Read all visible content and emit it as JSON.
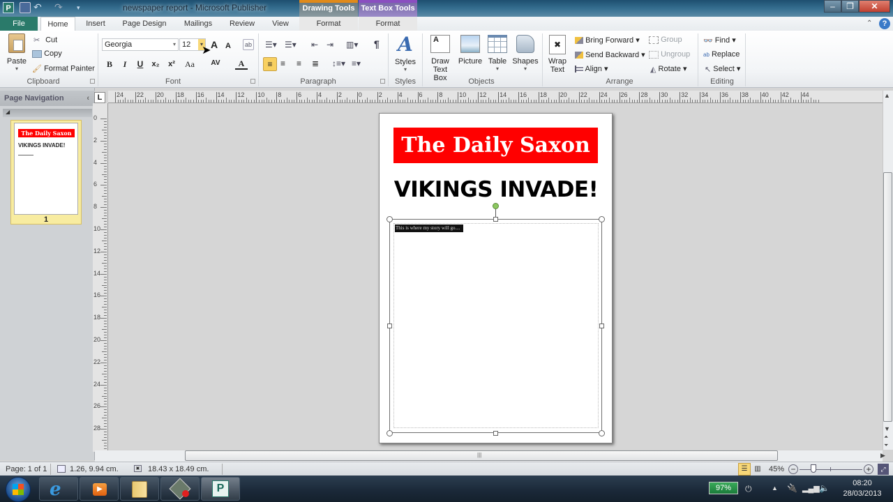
{
  "window": {
    "title": "newspaper report - Microsoft Publisher",
    "app_icon": "publisher-icon",
    "quick_access": [
      "save-icon",
      "undo-icon",
      "redo-icon",
      "customize-qat-icon"
    ],
    "controls": {
      "minimize": "–",
      "maximize": "❐",
      "close": "✕"
    }
  },
  "contextual_tabs": [
    {
      "group": "Drawing Tools",
      "tab": "Format",
      "color": "#e08a1a"
    },
    {
      "group": "Text Box Tools",
      "tab": "Format",
      "color": "#8a4ec0"
    }
  ],
  "tabs": [
    "File",
    "Home",
    "Insert",
    "Page Design",
    "Mailings",
    "Review",
    "View"
  ],
  "active_tab": "Home",
  "ribbon": {
    "clipboard": {
      "label": "Clipboard",
      "paste": "Paste",
      "cut": "Cut",
      "copy": "Copy",
      "format_painter": "Format Painter"
    },
    "font": {
      "label": "Font",
      "font_name": "Georgia",
      "font_size": "12",
      "bold": "B",
      "italic": "I",
      "underline": "U",
      "subscript": "x₂",
      "superscript": "x²",
      "change_case": "Aa",
      "char_spacing": "AV",
      "font_color": "A",
      "grow": "A",
      "shrink": "A"
    },
    "paragraph": {
      "label": "Paragraph",
      "show_marks": "¶"
    },
    "styles": {
      "label": "Styles",
      "button": "Styles"
    },
    "objects": {
      "label": "Objects",
      "draw_text_box": "Draw Text Box",
      "draw_text_box_l1": "Draw",
      "draw_text_box_l2": "Text Box",
      "picture": "Picture",
      "table": "Table",
      "shapes": "Shapes"
    },
    "arrange": {
      "label": "Arrange",
      "wrap_text_l1": "Wrap",
      "wrap_text_l2": "Text",
      "bring_forward": "Bring Forward",
      "send_backward": "Send Backward",
      "align": "Align",
      "group": "Group",
      "ungroup": "Ungroup",
      "rotate": "Rotate"
    },
    "editing": {
      "label": "Editing",
      "find": "Find",
      "replace": "Replace",
      "select": "Select"
    }
  },
  "nav_pane": {
    "title": "Page Navigation",
    "pages": [
      {
        "number": "1",
        "masthead": "The Daily Saxon",
        "headline": "VIKINGS INVADE!"
      }
    ]
  },
  "ruler": {
    "corner": "L",
    "horizontal_ticks": [
      "24",
      "22",
      "20",
      "18",
      "16",
      "14",
      "12",
      "10",
      "8",
      "6",
      "4",
      "2",
      "0",
      "2",
      "4",
      "6",
      "8",
      "10",
      "12",
      "14",
      "16",
      "18",
      "20",
      "22",
      "24",
      "26",
      "28",
      "30",
      "32",
      "34",
      "36",
      "38",
      "40",
      "42",
      "44"
    ],
    "vertical_ticks": [
      "0",
      "2",
      "4",
      "6",
      "8",
      "10",
      "12",
      "14",
      "16",
      "18",
      "20",
      "22",
      "24",
      "26",
      "28"
    ]
  },
  "document": {
    "masthead": "The Daily Saxon",
    "masthead_bg": "#ff0000",
    "headline": "VIKINGS INVADE!",
    "story_placeholder": "This is where my story will go...."
  },
  "status_bar": {
    "page": "Page: 1 of 1",
    "position": "1.26, 9.94 cm.",
    "size": "18.43 x 18.49 cm.",
    "zoom": "45%",
    "zoom_level_percent": 45
  },
  "taskbar": {
    "items": [
      "start-button",
      "internet-explorer",
      "media-player",
      "windows-explorer",
      "app-unknown",
      "microsoft-publisher"
    ],
    "battery": "97%",
    "time": "08:20",
    "date": "28/03/2013"
  }
}
